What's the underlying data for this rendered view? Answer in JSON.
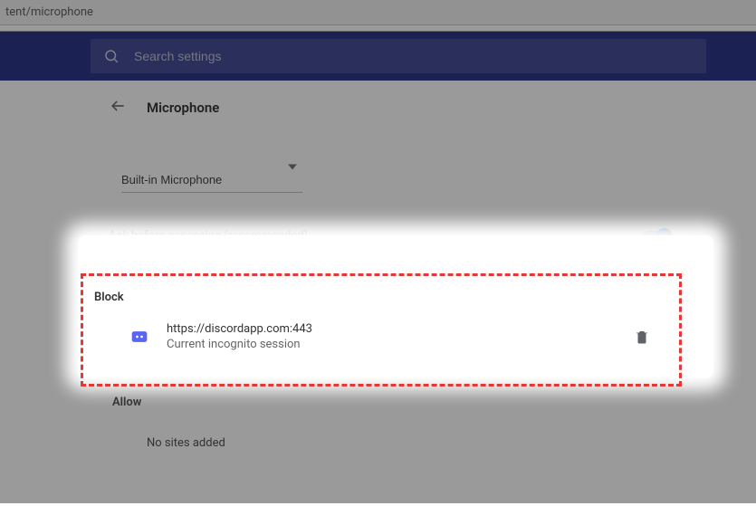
{
  "url_fragment": "tent/microphone",
  "search": {
    "placeholder": "Search settings"
  },
  "page": {
    "title": "Microphone"
  },
  "device": {
    "selected": "Built-in Microphone"
  },
  "toggle": {
    "label": "Ask before accessing (recommended)",
    "on": true
  },
  "block": {
    "header": "Block",
    "items": [
      {
        "url": "https://discordapp.com:443",
        "subtext": "Current incognito session",
        "icon": "discord"
      }
    ]
  },
  "allow": {
    "header": "Allow",
    "empty_text": "No sites added"
  }
}
